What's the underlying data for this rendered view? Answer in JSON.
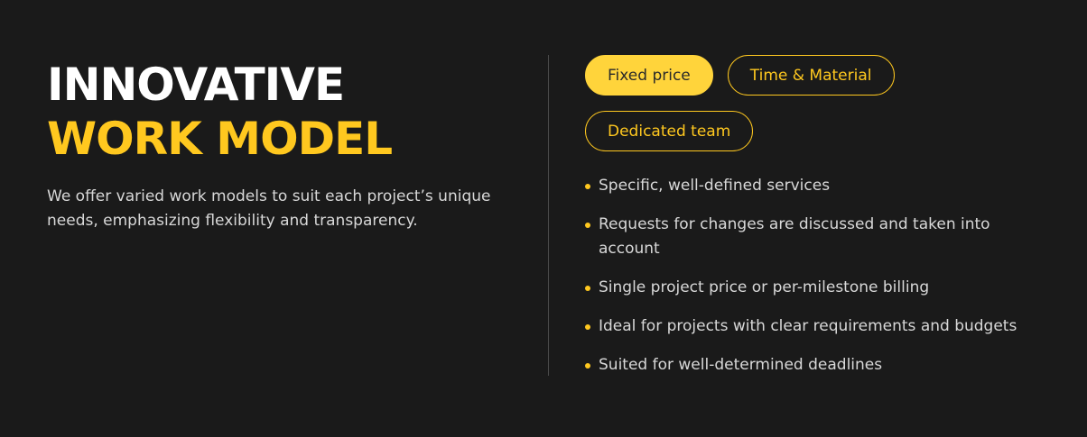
{
  "heading": {
    "line1": "INNOVATIVE",
    "line2": "WORK MODEL"
  },
  "description": "We offer varied work models to suit each project’s unique needs, emphasizing flexibility and transparency.",
  "tabs": [
    {
      "label": "Fixed price",
      "active": true
    },
    {
      "label": "Time & Material",
      "active": false
    },
    {
      "label": "Dedicated team",
      "active": false
    }
  ],
  "features": [
    "Specific, well-defined services",
    "Requests for changes are discussed and taken into account",
    "Single project price or per-milestone billing",
    "Ideal for projects with clear requirements and budgets",
    "Suited for well-determined deadlines"
  ],
  "colors": {
    "background": "#1a1a1a",
    "accent": "#ffc81f",
    "text": "#d8d8d8"
  }
}
